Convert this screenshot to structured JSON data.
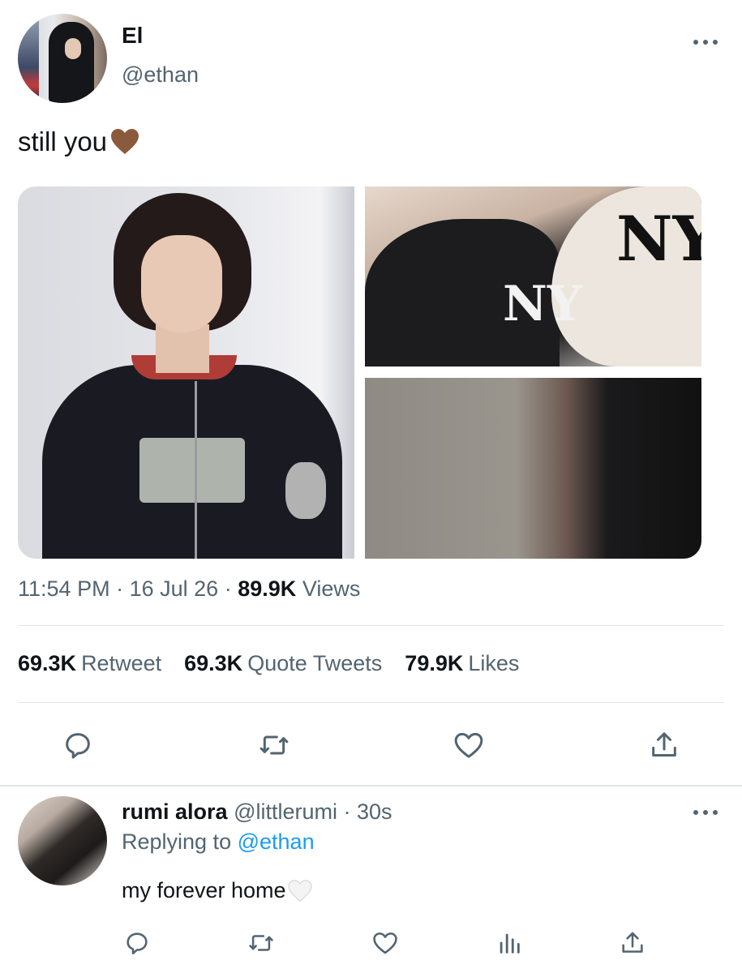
{
  "tweet": {
    "display_name": "El",
    "handle": "@ethan",
    "text": "still you",
    "emoji": "brown-heart-icon",
    "time": "11:54 PM",
    "date": "16 Jul 26",
    "views_count": "89.9K",
    "views_label": "Views",
    "separator": "·"
  },
  "stats": {
    "retweets_count": "69.3K",
    "retweets_label": "Retweet",
    "quotes_count": "69.3K",
    "quotes_label": "Quote Tweets",
    "likes_count": "79.9K",
    "likes_label": "Likes"
  },
  "actions": [
    "reply-icon",
    "retweet-icon",
    "like-icon",
    "share-icon"
  ],
  "reply": {
    "display_name": "rumi alora",
    "handle": "@littlerumi",
    "separator": "·",
    "time": "30s",
    "replying_label": "Replying to",
    "replying_handle": "@ethan",
    "text": "my forever home",
    "emoji": "white-heart-icon",
    "actions": [
      "reply-icon",
      "retweet-icon",
      "like-icon",
      "analytics-icon",
      "share-icon"
    ]
  },
  "colors": {
    "text": "#0f1419",
    "secondary": "#536471",
    "link": "#1d9bf0",
    "divider": "#e1e4e8",
    "brown_heart": "#8b5a3c"
  }
}
